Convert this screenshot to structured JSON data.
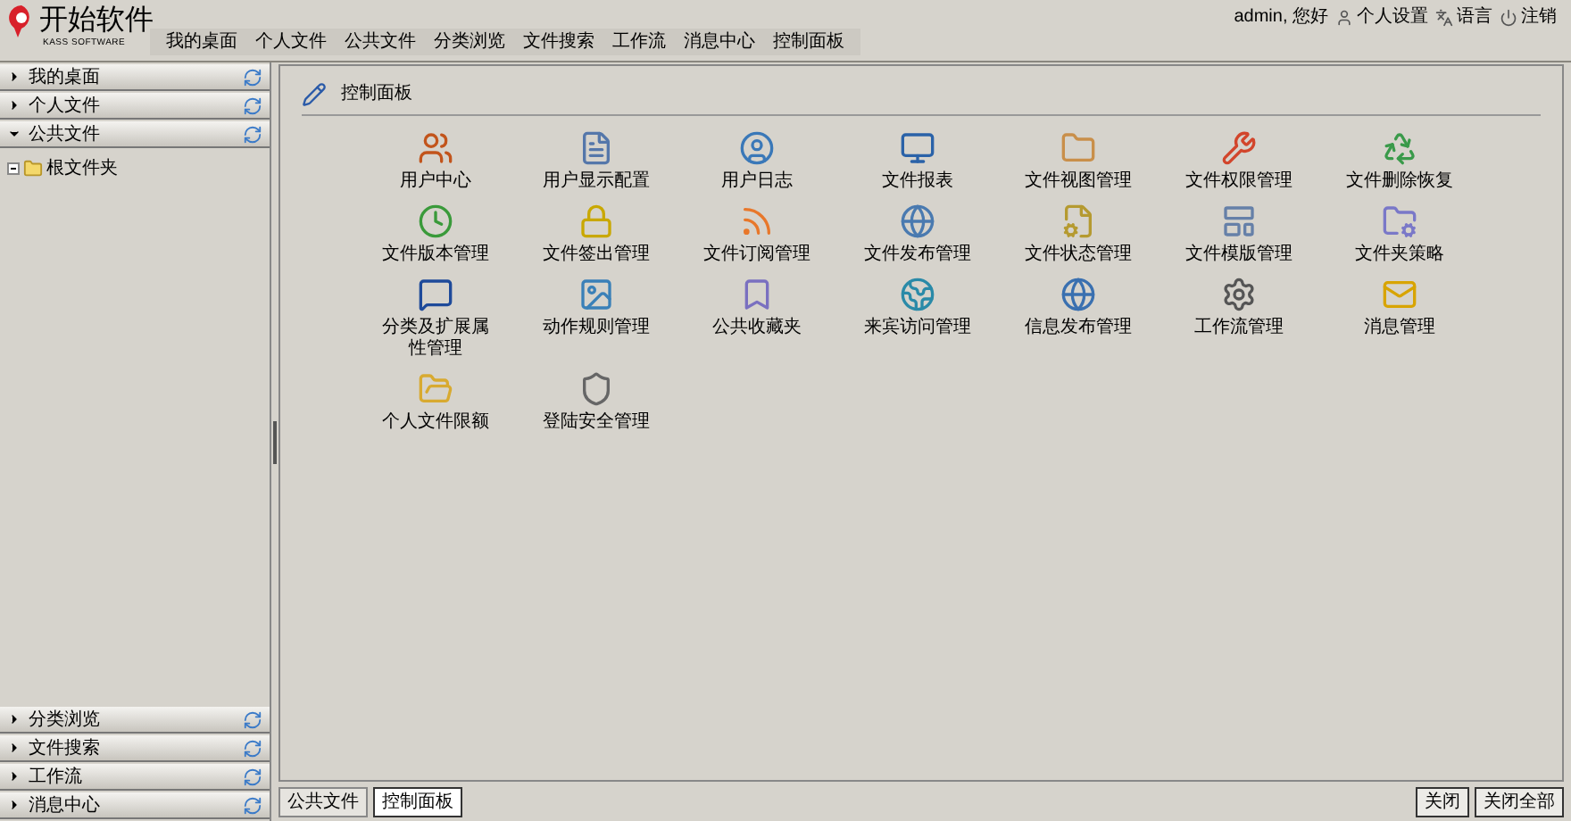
{
  "logo": {
    "name": "开始软件",
    "tagline": "KASS SOFTWARE"
  },
  "nav": [
    {
      "label": "我的桌面"
    },
    {
      "label": "个人文件"
    },
    {
      "label": "公共文件"
    },
    {
      "label": "分类浏览"
    },
    {
      "label": "文件搜索"
    },
    {
      "label": "工作流"
    },
    {
      "label": "消息中心"
    },
    {
      "label": "控制面板"
    }
  ],
  "user_bar": {
    "greeting": "admin, 您好",
    "links": [
      {
        "label": "个人设置"
      },
      {
        "label": "语言"
      },
      {
        "label": "注销"
      }
    ]
  },
  "sidebar": {
    "top_sections": [
      {
        "label": "我的桌面",
        "expanded": false
      },
      {
        "label": "个人文件",
        "expanded": false
      },
      {
        "label": "公共文件",
        "expanded": true,
        "tree": [
          {
            "label": "根文件夹"
          }
        ]
      }
    ],
    "bottom_sections": [
      {
        "label": "分类浏览",
        "expanded": false
      },
      {
        "label": "文件搜索",
        "expanded": false
      },
      {
        "label": "工作流",
        "expanded": false
      },
      {
        "label": "消息中心",
        "expanded": false
      }
    ]
  },
  "panel": {
    "title": "控制面板",
    "items": [
      {
        "label": "用户中心"
      },
      {
        "label": "用户显示配置"
      },
      {
        "label": "用户日志"
      },
      {
        "label": "文件报表"
      },
      {
        "label": "文件视图管理"
      },
      {
        "label": "文件权限管理"
      },
      {
        "label": "文件删除恢复"
      },
      {
        "label": "文件版本管理"
      },
      {
        "label": "文件签出管理"
      },
      {
        "label": "文件订阅管理"
      },
      {
        "label": "文件发布管理"
      },
      {
        "label": "文件状态管理"
      },
      {
        "label": "文件模版管理"
      },
      {
        "label": "文件夹策略"
      },
      {
        "label": "分类及扩展属性管理"
      },
      {
        "label": "动作规则管理"
      },
      {
        "label": "公共收藏夹"
      },
      {
        "label": "来宾访问管理"
      },
      {
        "label": "信息发布管理"
      },
      {
        "label": "工作流管理"
      },
      {
        "label": "消息管理"
      },
      {
        "label": "个人文件限额"
      },
      {
        "label": "登陆安全管理"
      }
    ]
  },
  "bottom_tabs": [
    {
      "label": "公共文件",
      "selected": false
    },
    {
      "label": "控制面板",
      "selected": true
    }
  ],
  "buttons": [
    {
      "label": "关闭"
    },
    {
      "label": "关闭全部"
    }
  ]
}
